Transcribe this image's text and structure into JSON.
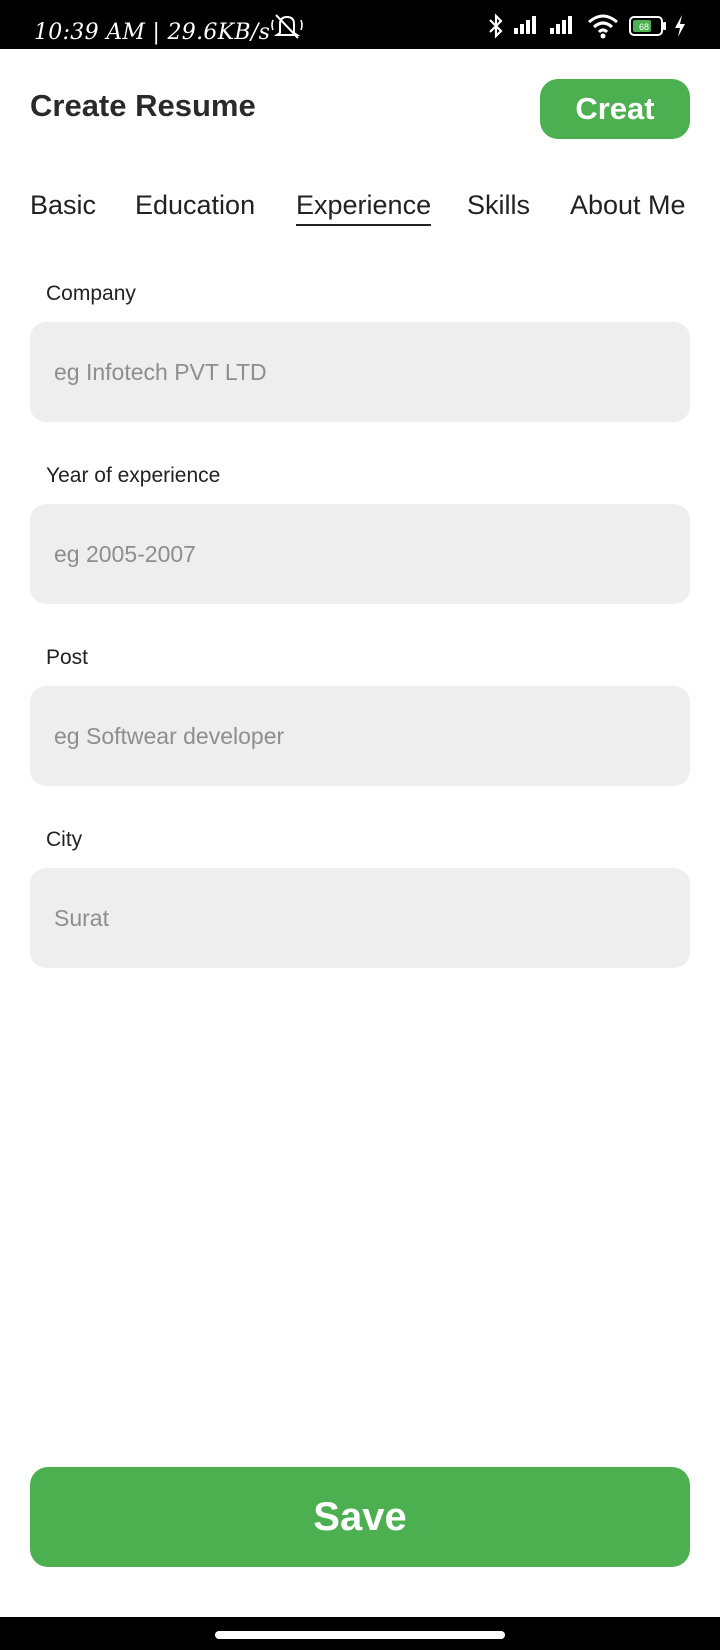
{
  "status_bar": {
    "text": "10:39 AM | 29.6KB/s",
    "battery_level": "68",
    "icons": [
      "mute-bell-icon",
      "bluetooth-icon",
      "signal-icon",
      "signal-icon",
      "wifi-icon",
      "battery-icon",
      "charging-icon"
    ]
  },
  "header": {
    "title": "Create Resume",
    "create_label": "Creat"
  },
  "tabs": [
    {
      "label": "Basic",
      "active": false
    },
    {
      "label": "Education",
      "active": false
    },
    {
      "label": "Experience",
      "active": true
    },
    {
      "label": "Skills",
      "active": false
    },
    {
      "label": "About Me",
      "active": false
    }
  ],
  "form": {
    "fields": [
      {
        "label": "Company",
        "placeholder": "eg Infotech PVT LTD",
        "value": ""
      },
      {
        "label": "Year of experience",
        "placeholder": "eg 2005-2007",
        "value": ""
      },
      {
        "label": "Post",
        "placeholder": "eg Softwear developer",
        "value": ""
      },
      {
        "label": "City",
        "placeholder": "Surat",
        "value": ""
      }
    ]
  },
  "save_label": "Save",
  "colors": {
    "accent": "#4caf50",
    "input_bg": "#eeeeee"
  }
}
